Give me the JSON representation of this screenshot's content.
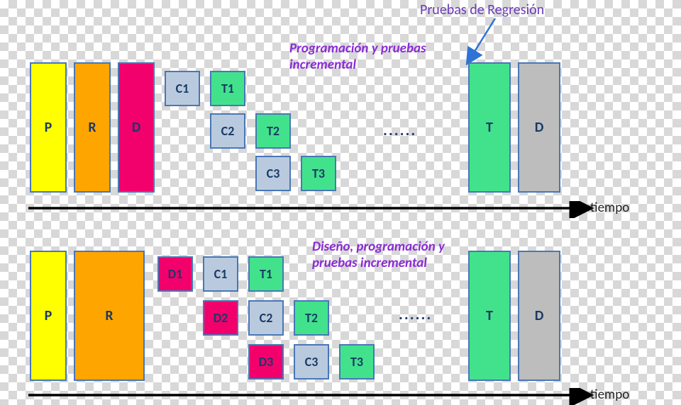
{
  "titles": {
    "regression": "Pruebas de Regresión",
    "caption1": "Programación y pruebas incremental",
    "caption2": "Diseño, programación y pruebas incremental"
  },
  "labels": {
    "P": "P",
    "R": "R",
    "D": "D",
    "C1": "C1",
    "T1": "T1",
    "C2": "C2",
    "T2": "T2",
    "C3": "C3",
    "T3": "T3",
    "D1": "D1",
    "D2": "D2",
    "D3": "D3",
    "T": "T",
    "dots": "......",
    "time": "tiempo"
  },
  "colors": {
    "yellow": "#ffff00",
    "orange": "#ffa500",
    "pink": "#f2006c",
    "lightblue": "#bacade",
    "green": "#42e28d",
    "grey": "#bdbdbd",
    "border": "#4877b6"
  }
}
